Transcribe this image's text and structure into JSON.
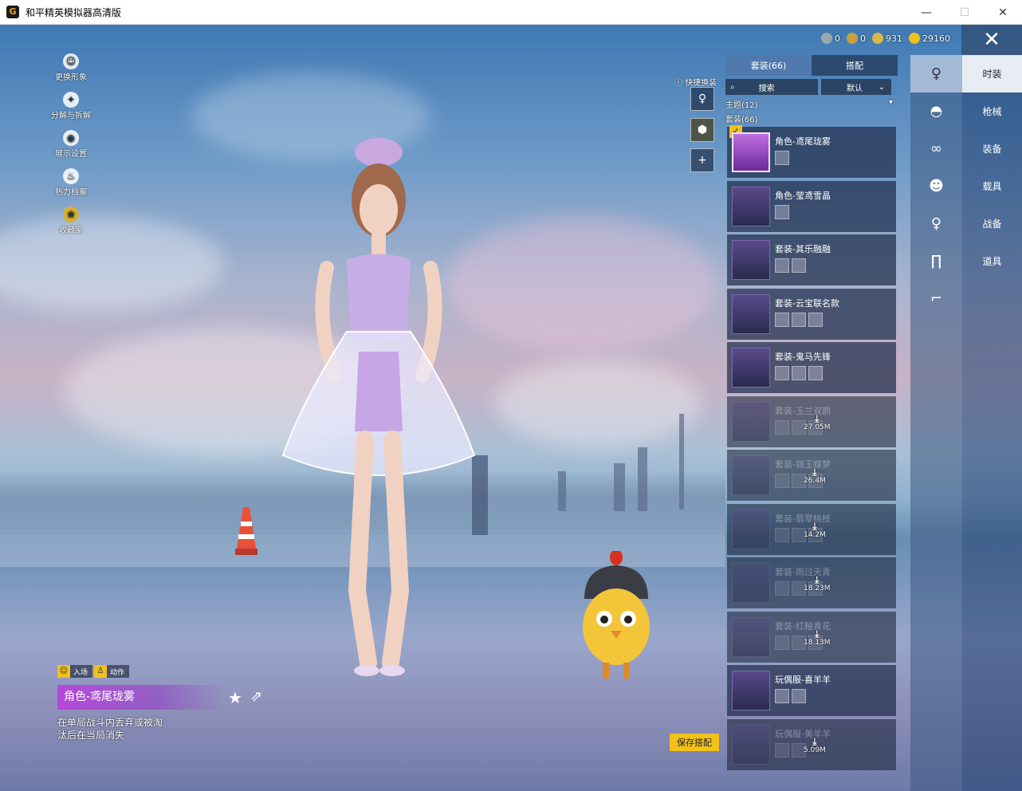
{
  "window": {
    "title": "和平精英模拟器高清版",
    "app_icon": "G"
  },
  "currencies": [
    {
      "icon": "coin-gray-icon",
      "value": "0"
    },
    {
      "icon": "coin-bronze-icon",
      "value": "0"
    },
    {
      "icon": "coin-silver-icon",
      "value": "931"
    },
    {
      "icon": "coin-gold-icon",
      "value": "29160"
    }
  ],
  "left_menu": [
    {
      "icon": "avatar-icon",
      "label": "更换形象"
    },
    {
      "icon": "puzzle-icon",
      "label": "分解与拆解"
    },
    {
      "icon": "eye-icon",
      "label": "展示设置"
    },
    {
      "icon": "flame-icon",
      "label": "热力档案"
    },
    {
      "icon": "collection-icon",
      "label": "收藏家"
    }
  ],
  "quick_swap_label": "快捷换装",
  "tags": [
    {
      "icon": "smiley-icon",
      "label": "入场"
    },
    {
      "icon": "person-icon",
      "label": "动作"
    }
  ],
  "selected": {
    "name": "角色-鸢尾珑雾",
    "description": "在单局战斗内丢弃或被淘汰后在当局消失"
  },
  "save_button": "保存搭配",
  "panel": {
    "tabs": [
      "套装(66)",
      "搭配"
    ],
    "search_label": "搜索",
    "sort_label": "默认",
    "theme_label": "主题(12)",
    "suit_label": "套装(66)",
    "items": [
      {
        "name": "角色-鸢尾珑雾",
        "subs": 1,
        "selected": true
      },
      {
        "name": "角色-莹鸢雪晶",
        "subs": 1
      },
      {
        "name": "套装-其乐融融",
        "subs": 2
      },
      {
        "name": "套装-云宝联名款",
        "subs": 3
      },
      {
        "name": "套装-鬼马先锋",
        "subs": 3
      },
      {
        "name": "套装-玉兰双鹊",
        "subs": 3,
        "download": "27.05M"
      },
      {
        "name": "套装-锦玉蝶梦",
        "subs": 3,
        "download": "26.4M"
      },
      {
        "name": "套装-翡翠桃枝",
        "subs": 3,
        "download": "14.2M"
      },
      {
        "name": "套装-雨过天青",
        "subs": 3,
        "download": "18.23M"
      },
      {
        "name": "套装-红釉青花",
        "subs": 3,
        "download": "18.13M"
      },
      {
        "name": "玩偶服-喜羊羊",
        "subs": 2
      },
      {
        "name": "玩偶服-美羊羊",
        "subs": 2,
        "download": "5.09M"
      }
    ]
  },
  "categories": [
    "person-icon",
    "cap-icon",
    "goggles-icon",
    "mask-icon",
    "figure-icon",
    "pants-icon",
    "shoes-icon"
  ],
  "nav": [
    "时装",
    "枪械",
    "装备",
    "载具",
    "战备",
    "道具"
  ]
}
